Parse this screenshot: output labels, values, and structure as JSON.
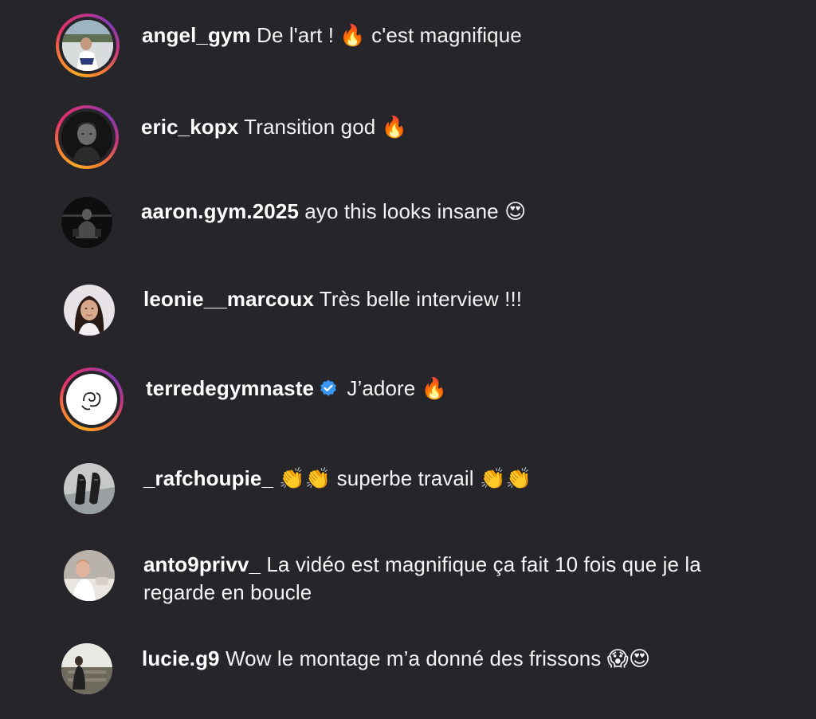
{
  "comments": [
    {
      "username": "angel_gym",
      "text": "De l'art ! 🔥 c'est magnifique",
      "story_ring": true,
      "verified": false
    },
    {
      "username": "eric_kopx",
      "text": "Transition god 🔥",
      "story_ring": true,
      "verified": false
    },
    {
      "username": "aaron.gym.2025",
      "text": "ayo this looks insane 😍",
      "story_ring": false,
      "verified": false
    },
    {
      "username": "leonie__marcoux",
      "text": "Très belle interview !!!",
      "story_ring": false,
      "verified": false
    },
    {
      "username": "terredegymnaste",
      "text": "J’adore 🔥",
      "story_ring": true,
      "verified": true
    },
    {
      "username": "_rafchoupie_",
      "text": "👏👏 superbe travail 👏👏",
      "story_ring": false,
      "verified": false
    },
    {
      "username": "anto9privv_",
      "text": "La vidéo est magnifique ça fait 10 fois que je la",
      "text_line2": "regarde en boucle",
      "story_ring": false,
      "verified": false
    },
    {
      "username": "lucie.g9",
      "text": "Wow le montage m’a donné des frissons 😱😍",
      "story_ring": false,
      "verified": false
    }
  ],
  "colors": {
    "background": "#25252a",
    "text": "#f3f3f3",
    "verified_badge": "#3897f0",
    "story_ring": [
      "#f9a825",
      "#e1306c",
      "#833ab4"
    ]
  }
}
